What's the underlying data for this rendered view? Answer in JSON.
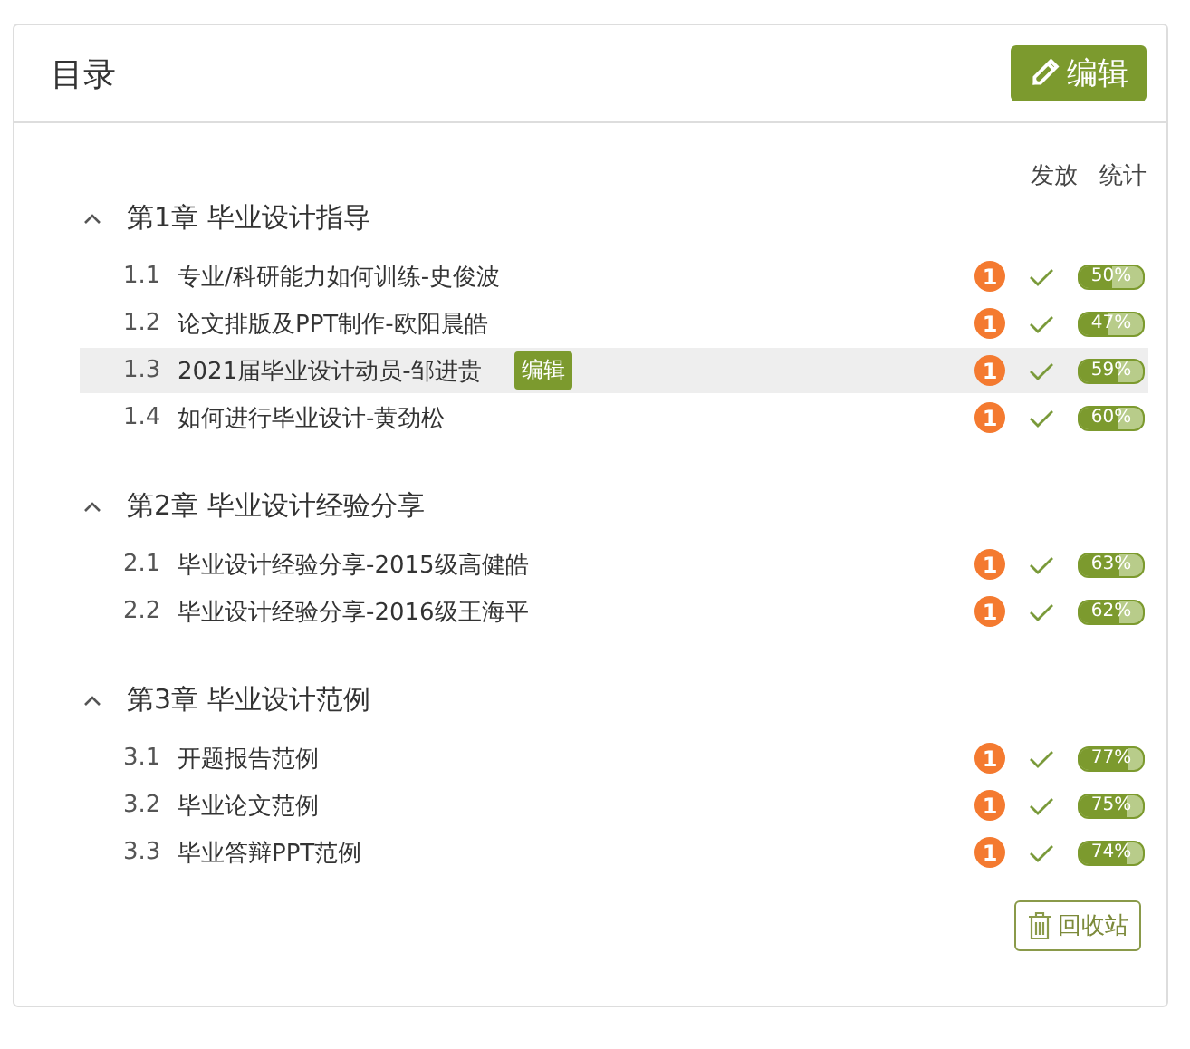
{
  "header": {
    "title": "目录",
    "edit_button": "编辑"
  },
  "columns": [
    "发放",
    "统计"
  ],
  "chapters": [
    {
      "title": "第1章 毕业设计指导",
      "expanded": true,
      "lessons": [
        {
          "number": "1.1",
          "title": "专业/科研能力如何训练-史俊波",
          "selected": false,
          "badge": "1",
          "issued": true,
          "level": 0.5,
          "reading": "50%"
        },
        {
          "number": "1.2",
          "title": "论文排版及PPT制作-欧阳晨皓",
          "selected": false,
          "badge": "1",
          "issued": true,
          "level": 0.47,
          "reading": "47%"
        },
        {
          "number": "1.3",
          "title": "2021届毕业设计动员-邹进贵",
          "selected": true,
          "edit_label": "编辑",
          "badge": "1",
          "issued": true,
          "level": 0.59,
          "reading": "59%"
        },
        {
          "number": "1.4",
          "title": "如何进行毕业设计-黄劲松",
          "selected": false,
          "badge": "1",
          "issued": true,
          "level": 0.6,
          "reading": "60%"
        }
      ]
    },
    {
      "title": "第2章 毕业设计经验分享",
      "expanded": true,
      "lessons": [
        {
          "number": "2.1",
          "title": "毕业设计经验分享-2015级高健皓",
          "selected": false,
          "badge": "1",
          "issued": true,
          "level": 0.63,
          "reading": "63%"
        },
        {
          "number": "2.2",
          "title": "毕业设计经验分享-2016级王海平",
          "selected": false,
          "badge": "1",
          "issued": true,
          "level": 0.62,
          "reading": "62%"
        }
      ]
    },
    {
      "title": "第3章 毕业设计范例",
      "expanded": true,
      "lessons": [
        {
          "number": "3.1",
          "title": "开题报告范例",
          "selected": false,
          "badge": "1",
          "issued": true,
          "level": 0.77,
          "reading": "77%"
        },
        {
          "number": "3.2",
          "title": "毕业论文范例",
          "selected": false,
          "badge": "1",
          "issued": true,
          "level": 0.75,
          "reading": "75%"
        },
        {
          "number": "3.3",
          "title": "毕业答辩PPT范例",
          "selected": false,
          "badge": "1",
          "issued": true,
          "level": 0.74,
          "reading": "74%"
        }
      ]
    }
  ],
  "recycle_button": "回收站"
}
